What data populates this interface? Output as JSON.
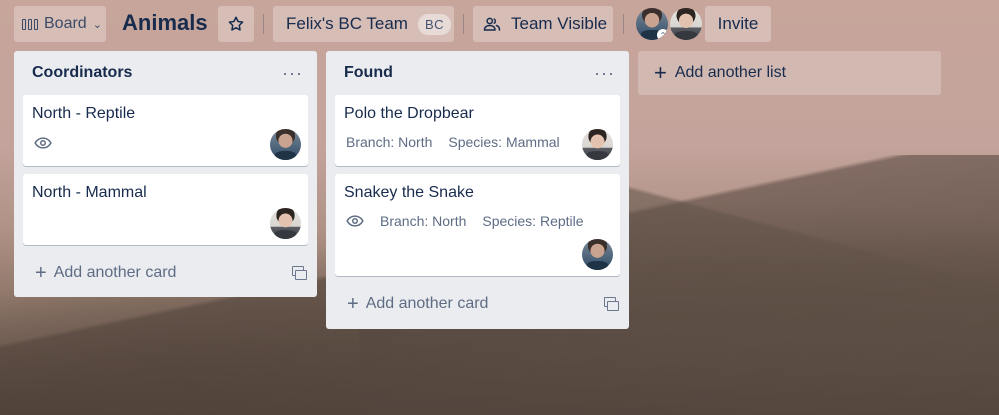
{
  "header": {
    "board_switcher_label": "Board",
    "board_title": "Animals",
    "team_name": "Felix's BC Team",
    "team_badge": "BC",
    "visibility_label": "Team Visible",
    "invite_label": "Invite",
    "members": [
      {
        "name": "member-1",
        "style": "dark"
      },
      {
        "name": "member-2",
        "style": "light"
      }
    ]
  },
  "lists": [
    {
      "title": "Coordinators",
      "menu": "···",
      "add_card_label": "Add another card",
      "cards": [
        {
          "title": "North - Reptile",
          "watching": true,
          "branch": "",
          "species": ""
        },
        {
          "title": "North - Mammal",
          "watching": false,
          "branch": "",
          "species": ""
        }
      ]
    },
    {
      "title": "Found",
      "menu": "···",
      "add_card_label": "Add another card",
      "cards": [
        {
          "title": "Polo the Dropbear",
          "watching": false,
          "branch": "Branch: North",
          "species": "Species: Mammal"
        },
        {
          "title": "Snakey the Snake",
          "watching": true,
          "branch": "Branch: North",
          "species": "Species: Reptile"
        }
      ]
    }
  ],
  "add_list_label": "Add another list",
  "colors": {
    "list_bg": "#ebecf0",
    "text_primary": "#172b4d",
    "text_secondary": "#5e6c84"
  }
}
